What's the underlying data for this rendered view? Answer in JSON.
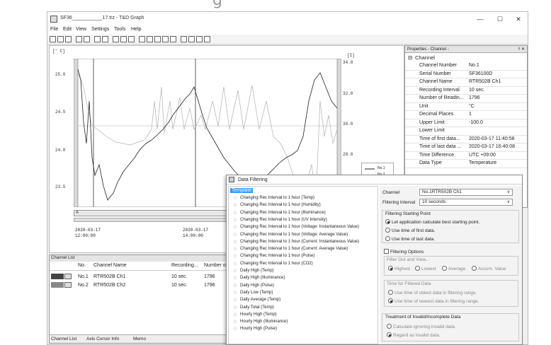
{
  "window": {
    "title": "SF36___________17.trz - T&D Graph",
    "minimize": "—",
    "maximize": "☐",
    "close": "✕"
  },
  "menu": [
    "File",
    "Edit",
    "View",
    "Settings",
    "Tools",
    "Help"
  ],
  "graph": {
    "y_unit": "[° C]",
    "y_left_ticks": [
      "25.0",
      "24.5",
      "24.0",
      "23.5"
    ],
    "y_right_unit": "[I]",
    "y_right_ticks": [
      "34.0",
      "32.0",
      "30.0",
      "28.0"
    ],
    "x_ticks": [
      {
        "date": "2020-03-17",
        "time": "12:00:00"
      },
      {
        "date": "2020-03-17",
        "time": "14:00:00"
      }
    ],
    "legend": [
      "No.1",
      "No.2"
    ],
    "scroll_label": "A"
  },
  "properties": {
    "header": "Properties - Channel -",
    "pin": "ᵖ ✕",
    "section": "Channel",
    "rows": [
      {
        "k": "Channel Number",
        "v": "No.1"
      },
      {
        "k": "Serial Number",
        "v": "SF36100D"
      },
      {
        "k": "Channel Name",
        "v": "RTR502B Ch1"
      },
      {
        "k": "Recording Interval",
        "v": "10 sec."
      },
      {
        "k": "Number of Readin...",
        "v": "1796"
      },
      {
        "k": "Unit",
        "v": "°C"
      },
      {
        "k": "Decimal Places",
        "v": "1"
      },
      {
        "k": "Upper Limit",
        "v": "-100.0"
      },
      {
        "k": "Lower Limit",
        "v": ""
      },
      {
        "k": "Time of first data...",
        "v": "2020-03-17 11:40:58"
      },
      {
        "k": "Time of last data ...",
        "v": "2020-03-17 16:40:08"
      },
      {
        "k": "Time Difference",
        "v": "UTC +09:00"
      },
      {
        "k": "Data Type",
        "v": "Temperature"
      }
    ]
  },
  "channel_list": {
    "header": "Channel List",
    "columns": [
      "No.",
      "Channel Name",
      "Recording...",
      "Number of"
    ],
    "rows": [
      {
        "no": "No.1",
        "name": "RTR502B Ch1",
        "rec": "10 sec.",
        "num": "1796"
      },
      {
        "no": "No.2",
        "name": "RTR502B Ch2",
        "rec": "10 sec.",
        "num": "1796"
      }
    ],
    "tabs": [
      "Channel List",
      "Axis Cursor Info",
      "Memo"
    ]
  },
  "dialog": {
    "title": "Data Filtering",
    "template_label": "Template",
    "items": [
      "Changing Rec Interval to 1 hour (Temp)",
      "Changing Rec Interval to 1 hour (Humidity)",
      "Changing Rec Interval to 1 hour (Illuminance)",
      "Changing Rec Interval to 1 hour (UV Intensity)",
      "Changing Rec Interval to 1 hour (Voltage: Instantaneous Value)",
      "Changing Rec Interval to 1 hour (Voltage: Average Value)",
      "Changing Rec Interval to 1 hour (Current: Instantaneous Value)",
      "Changing Rec Interval to 1 hour (Current: Average Value)",
      "Changing Rec Interval to 1 hour (Pulse)",
      "Changing Rec Interval to 1 hour (CO2)",
      "Daily High (Temp)",
      "Daily High (Illuminance)",
      "Daily High (Pulse)",
      "Daily Low (Temp)",
      "Daily Average (Temp)",
      "Daily Total (Temp)",
      "Hourly High (Temp)",
      "Hourly High (Illuminance)",
      "Hourly High (Pulse)"
    ],
    "channel_label": "Channel",
    "channel_value": "No.1RTR502B Ch1",
    "interval_label": "Filtering Interval",
    "interval_value": "10 seconds",
    "start_group": "Filtering Starting Point",
    "start_opts": [
      "Let application calculate best starting point.",
      "Use time of first data.",
      "Use time of last data."
    ],
    "options_label": "Filtering Options",
    "filter_group": "Filter Out and View...",
    "filter_opts": [
      "Highest",
      "Lowest",
      "Average",
      "Accum. Value"
    ],
    "time_group": "Time for Filtered Data",
    "time_opts": [
      "Use time of oldest data in filtering range.",
      "Use time of newest data in filtering range."
    ],
    "invalid_group": "Treatment of Invalid/Incomplete Data",
    "invalid_opts": [
      "Calculate ignoring invalid data.",
      "Regard as invalid data."
    ]
  }
}
